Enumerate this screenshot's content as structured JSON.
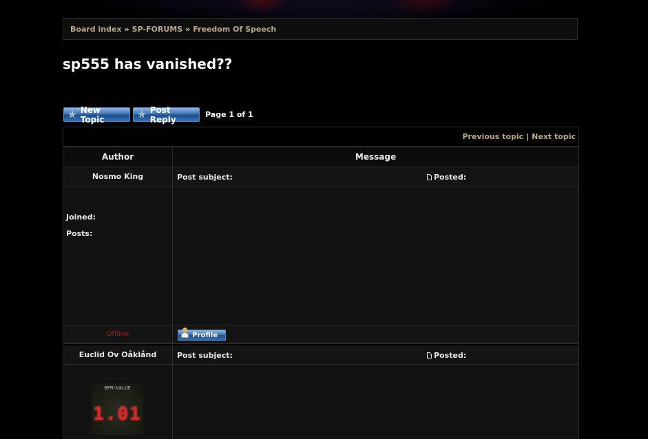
{
  "breadcrumb": {
    "items": [
      "Board index",
      "SP-FORUMS",
      "Freedom Of Speech"
    ],
    "separator": "»"
  },
  "topic": {
    "title": "sp555 has vanished??"
  },
  "actions": {
    "new_topic_label": "New Topic",
    "post_reply_label": "Post Reply",
    "pagination": "Page 1 of 1"
  },
  "topic_nav": {
    "previous": "Previous topic",
    "separator": "|",
    "next": "Next topic"
  },
  "table_header": {
    "author": "Author",
    "message": "Message"
  },
  "posts": [
    {
      "author": "Nosmo King",
      "subject_label": "Post subject:",
      "posted_label": "Posted:",
      "joined_label": "Joined:",
      "posts_label": "Posts:",
      "status": "Offline",
      "profile_label": "Profile"
    },
    {
      "author": "Euclid Ov Oåklånd",
      "subject_label": "Post subject:",
      "posted_label": "Posted:",
      "avatar": {
        "label": "BPM/VALUE",
        "digits": "1.01"
      }
    }
  ],
  "colors": {
    "background": "#000000",
    "link": "#b8a88a",
    "offline": "#b81818",
    "button_blue": "#3f74b3"
  }
}
